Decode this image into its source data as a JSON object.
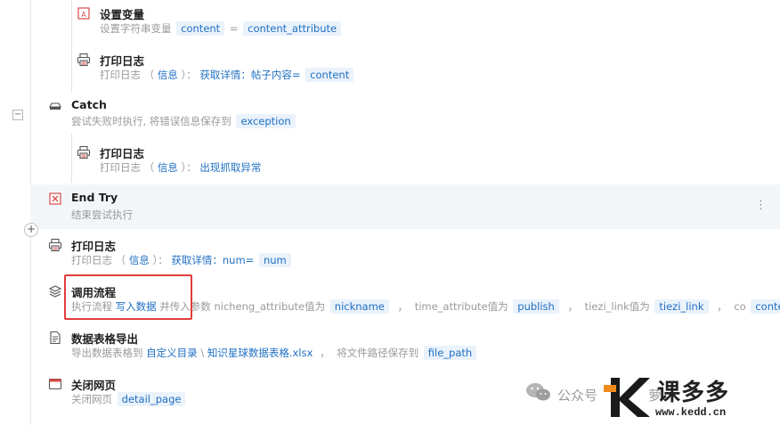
{
  "steps": {
    "set_var": {
      "title": "设置变量",
      "desc_prefix": "设置字符串变量",
      "var": "content",
      "eq": "=",
      "value": "content_attribute"
    },
    "log1": {
      "title": "打印日志",
      "desc_prefix": "打印日志",
      "paren_open": "（",
      "level": "信息",
      "paren_close": "）：",
      "text": "获取详情：帖子内容=",
      "var": "content"
    },
    "catch": {
      "title": "Catch",
      "desc_prefix": "尝试失败时执行, 将错误信息保存到",
      "var": "exception"
    },
    "log2": {
      "title": "打印日志",
      "desc_prefix": "打印日志",
      "paren_open": "（",
      "level": "信息",
      "paren_close": "）：",
      "text": "出现抓取异常"
    },
    "end_try": {
      "title": "End Try",
      "desc": "结束尝试执行"
    },
    "log3": {
      "title": "打印日志",
      "desc_prefix": "打印日志",
      "paren_open": "（",
      "level": "信息",
      "paren_close": "）：",
      "text": "获取详情：num=",
      "var": "num"
    },
    "call_flow": {
      "title": "调用流程",
      "desc_prefix": "执行流程",
      "flow": "写入数据",
      "pass_text": "并传入参数 nicheng_attribute值为",
      "v1": "nickname",
      "t2": "time_attribute值为",
      "v2": "publish",
      "t3": "tiezi_link值为",
      "v3": "tiezi_link",
      "t4": "co",
      "v4": "conte"
    },
    "export": {
      "title": "数据表格导出",
      "desc_prefix": "导出数据表格到",
      "dir": "自定义目录",
      "slash": "\\",
      "file": "知识星球数据表格.xlsx",
      "save_text": "将文件路径保存到",
      "var": "file_path"
    },
    "close_page": {
      "title": "关闭网页",
      "desc_prefix": "关闭网页",
      "var": "detail_page"
    }
  },
  "controls": {
    "collapse_symbol": "−",
    "add_symbol": "+",
    "more_symbol": "⋮",
    "comma": "，"
  },
  "watermark": {
    "wechat_text": "公众号",
    "extra": "萝",
    "brand": "课多多",
    "domain": "www.kedd.cn"
  },
  "colors": {
    "accent": "#1f6fc2",
    "chip_bg": "#eaf2fb",
    "highlight_row": "#f3f6f9",
    "red_box": "#e23c3c",
    "logo_orange": "#f08a1c"
  },
  "icons": [
    "variable-icon",
    "printer-icon",
    "catch-icon",
    "end-try-icon",
    "flow-layers-icon",
    "table-export-icon",
    "browser-icon",
    "wechat-icon"
  ]
}
